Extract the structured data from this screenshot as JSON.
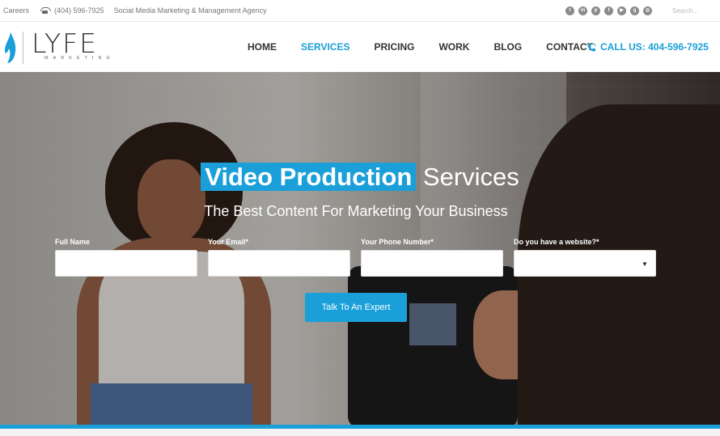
{
  "topbar": {
    "careers": "Careers",
    "phone": "(404) 596-7925",
    "tagline": "Social Media Marketing & Management Agency",
    "socials": [
      "twitter-icon",
      "linkedin-icon",
      "pinterest-icon",
      "facebook-icon",
      "youtube-icon",
      "googleplus-icon",
      "instagram-icon"
    ],
    "search_placeholder": "Search..."
  },
  "header": {
    "brand": "LYFE",
    "brand_sub": "MARKETING",
    "nav": [
      "HOME",
      "SERVICES",
      "PRICING",
      "WORK",
      "BLOG",
      "CONTACT"
    ],
    "active_nav": "SERVICES",
    "call": "CALL US: 404-596-7925"
  },
  "hero": {
    "headline_highlight": "Video Production",
    "headline_rest": "Services",
    "subhead": "The Best Content For Marketing Your Business",
    "form": {
      "full_name_label": "Full Name",
      "email_label": "Your Email*",
      "phone_label": "Your Phone Number*",
      "website_label": "Do you have a website?*"
    },
    "cta": "Talk To An Expert"
  },
  "colors": {
    "accent": "#1a9fd8",
    "text": "#333333"
  }
}
